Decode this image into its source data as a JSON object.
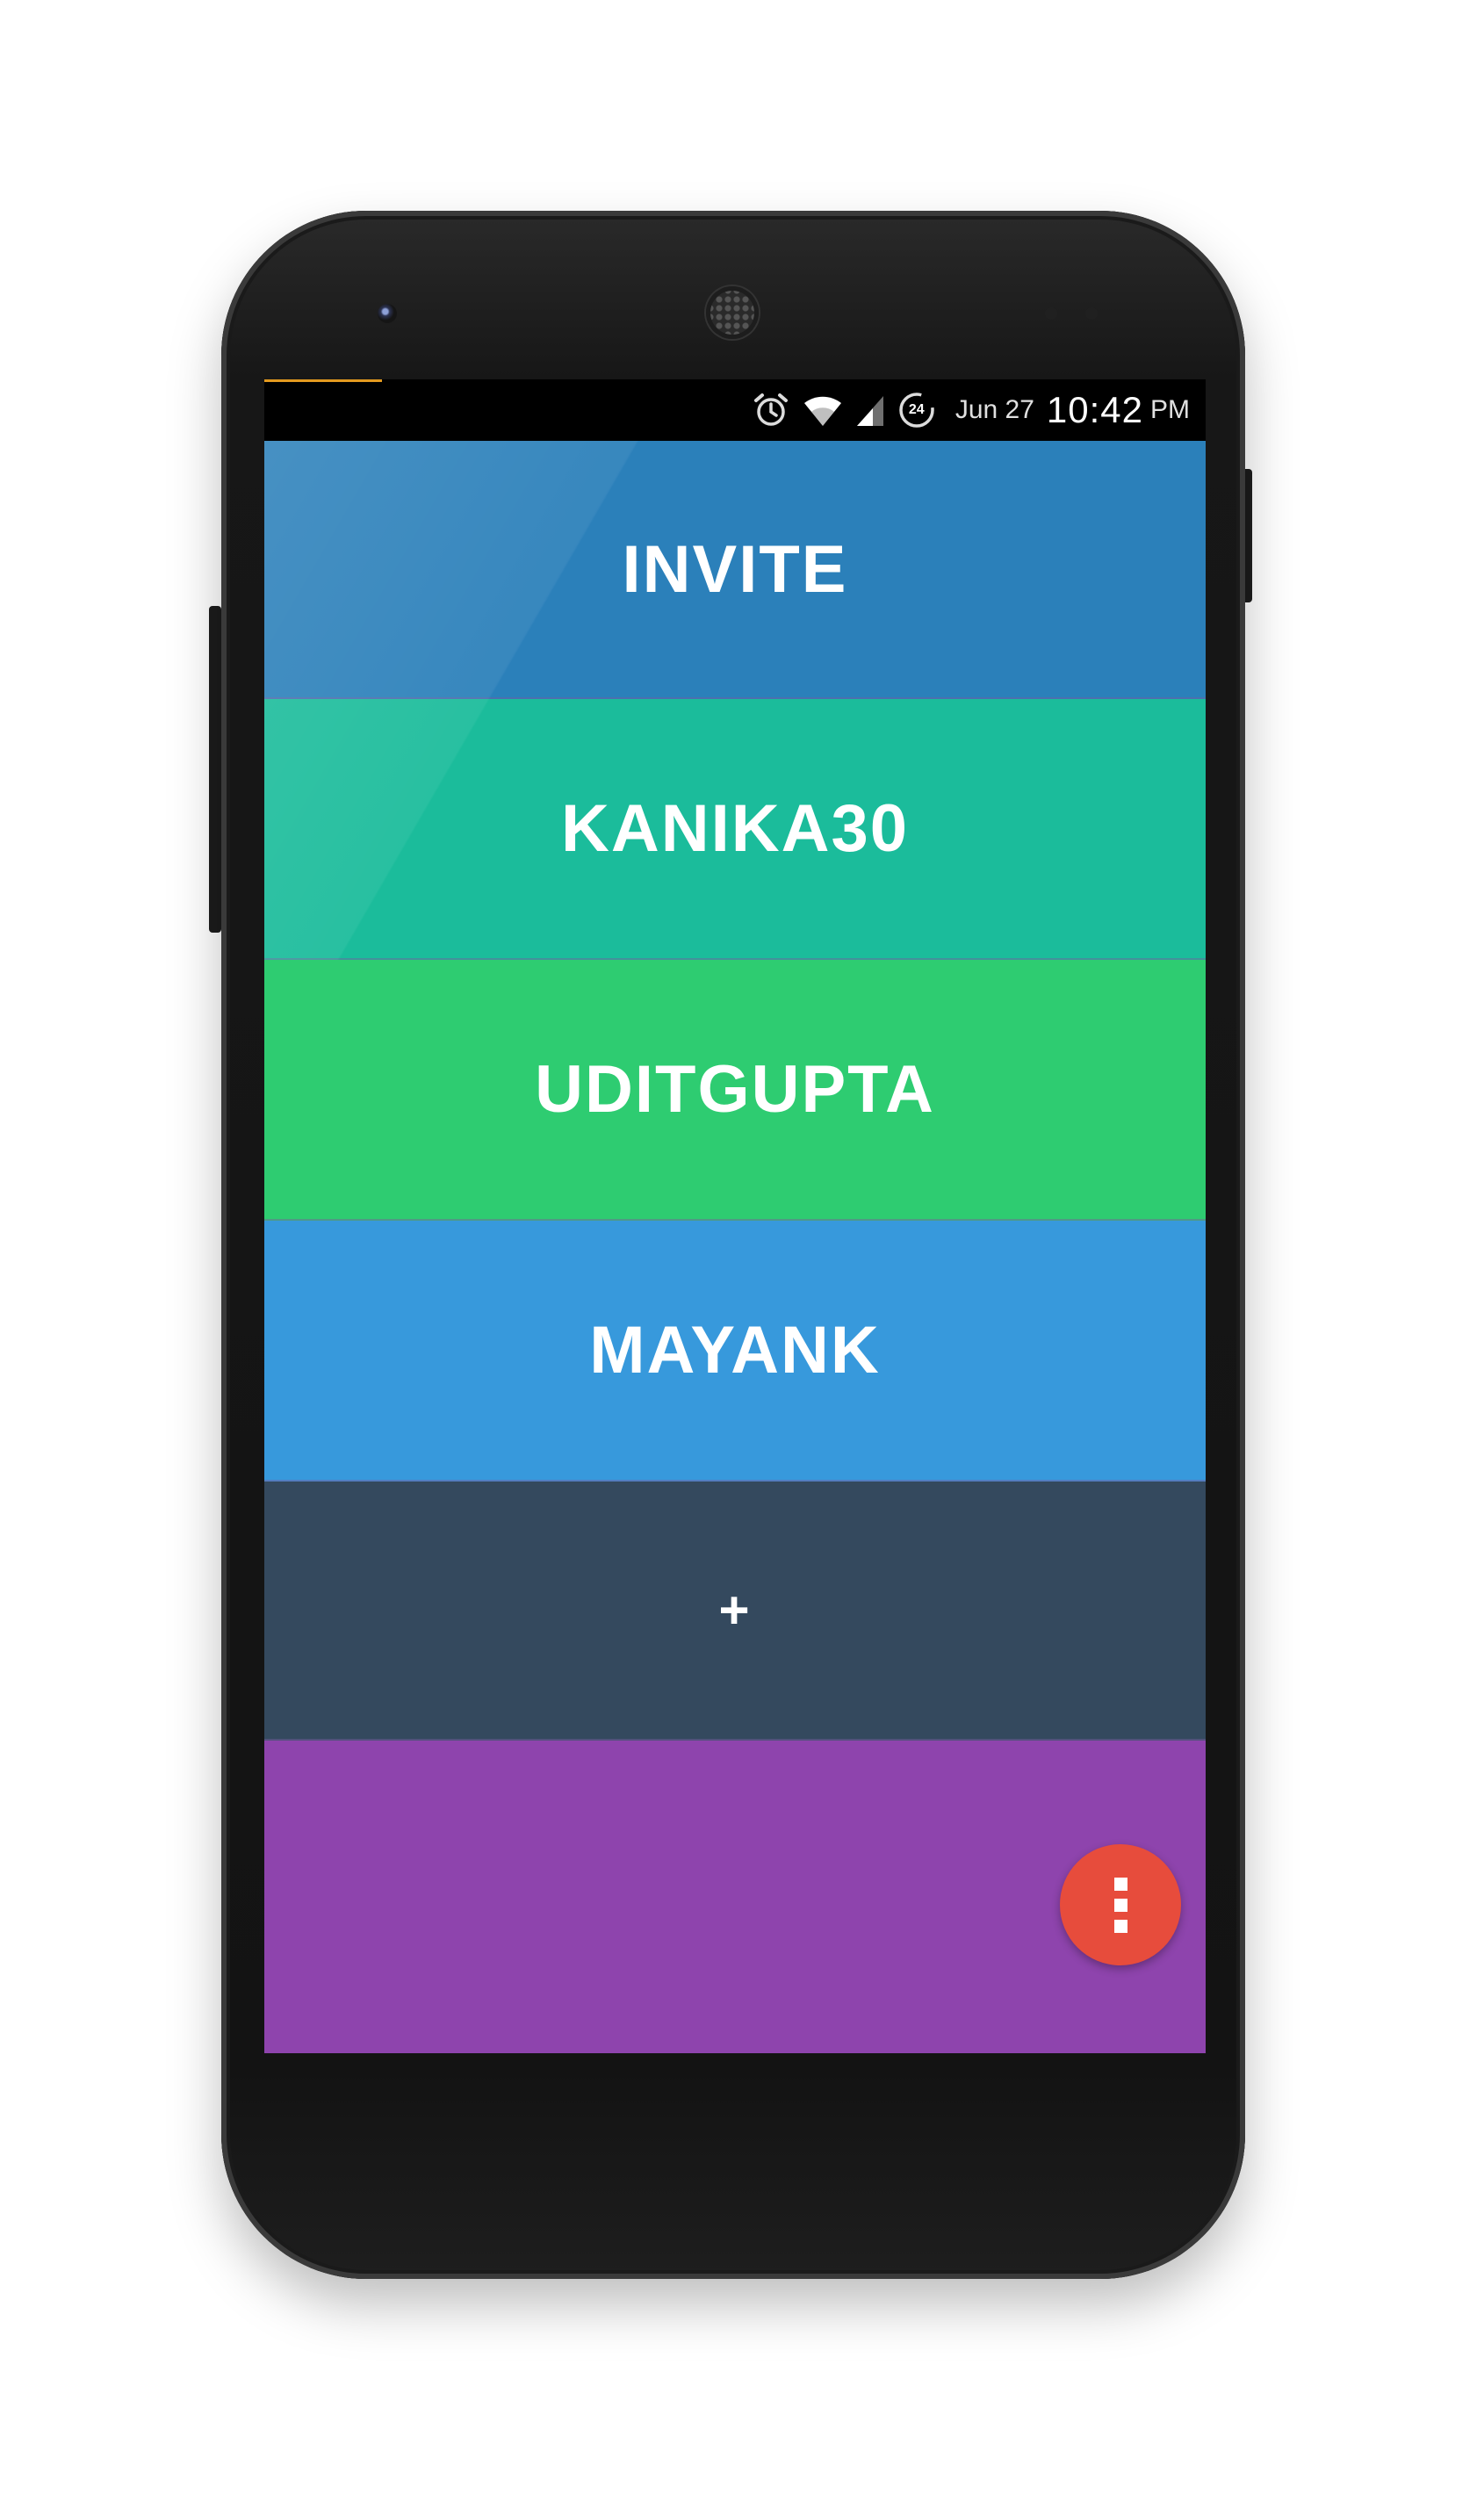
{
  "status_bar": {
    "date": "Jun 27",
    "time": "10:42",
    "ampm": "PM",
    "data_badge": "24",
    "icons": [
      "alarm-icon",
      "wifi-icon",
      "signal-icon",
      "data-saver-icon"
    ],
    "accent_color": "#e39a1f"
  },
  "list": {
    "items": [
      {
        "label": "INVITE",
        "color": "#2b80ba"
      },
      {
        "label": "KANIKA30",
        "color": "#1bbc9b"
      },
      {
        "label": "UDITGUPTA",
        "color": "#2ecc71"
      },
      {
        "label": "MAYANK",
        "color": "#3799dc"
      },
      {
        "label": "+",
        "color": "#34495e"
      },
      {
        "label": "",
        "color": "#8e44ad"
      }
    ]
  },
  "fab": {
    "icon": "more-vert-icon",
    "color": "#e74c3c"
  }
}
